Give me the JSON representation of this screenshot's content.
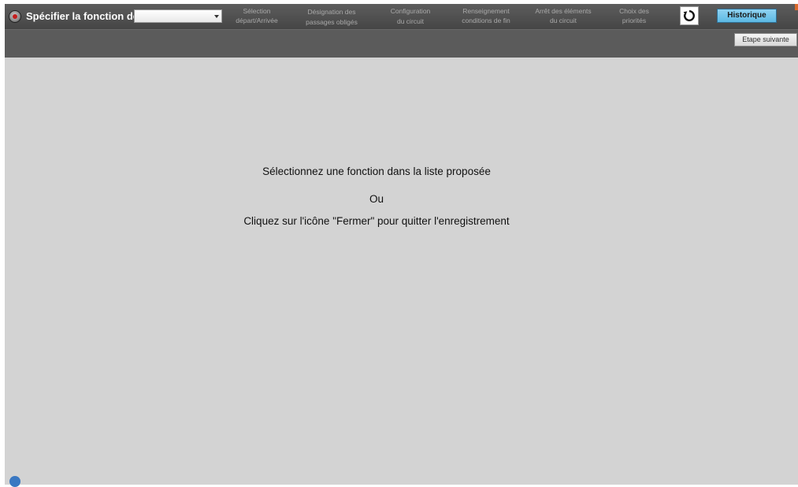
{
  "toolbar": {
    "function_label": "Spécifier la fonction de :",
    "function_select_value": "",
    "history_label": "Historique"
  },
  "steps": [
    {
      "line1": "Sélection",
      "line2": "départ/Arrivée"
    },
    {
      "line1": "Désignation des",
      "line2": "passages obligés"
    },
    {
      "line1": "Configuration",
      "line2": "du circuit"
    },
    {
      "line1": "Renseignement",
      "line2": "conditions de fin"
    },
    {
      "line1": "Arrêt des éléments",
      "line2": "du circuit"
    },
    {
      "line1": "Choix des",
      "line2": "priorités"
    }
  ],
  "subbar": {
    "next_step_label": "Etape suivante"
  },
  "main": {
    "instruction": "Sélectionnez une fonction dans la liste proposée",
    "or": "Ou",
    "close_hint": "Cliquez sur l'icône \"Fermer\" pour quitter l'enregistrement"
  },
  "icons": {
    "record": "record-icon",
    "refresh": "refresh-icon",
    "dropdown": "chevron-down-icon"
  },
  "colors": {
    "toolbar_bg": "#4f4f4f",
    "content_bg": "#d3d3d3",
    "history_accent": "#5cb8e3",
    "record_red": "#c41e1e",
    "step_text": "#a9a9a9"
  }
}
